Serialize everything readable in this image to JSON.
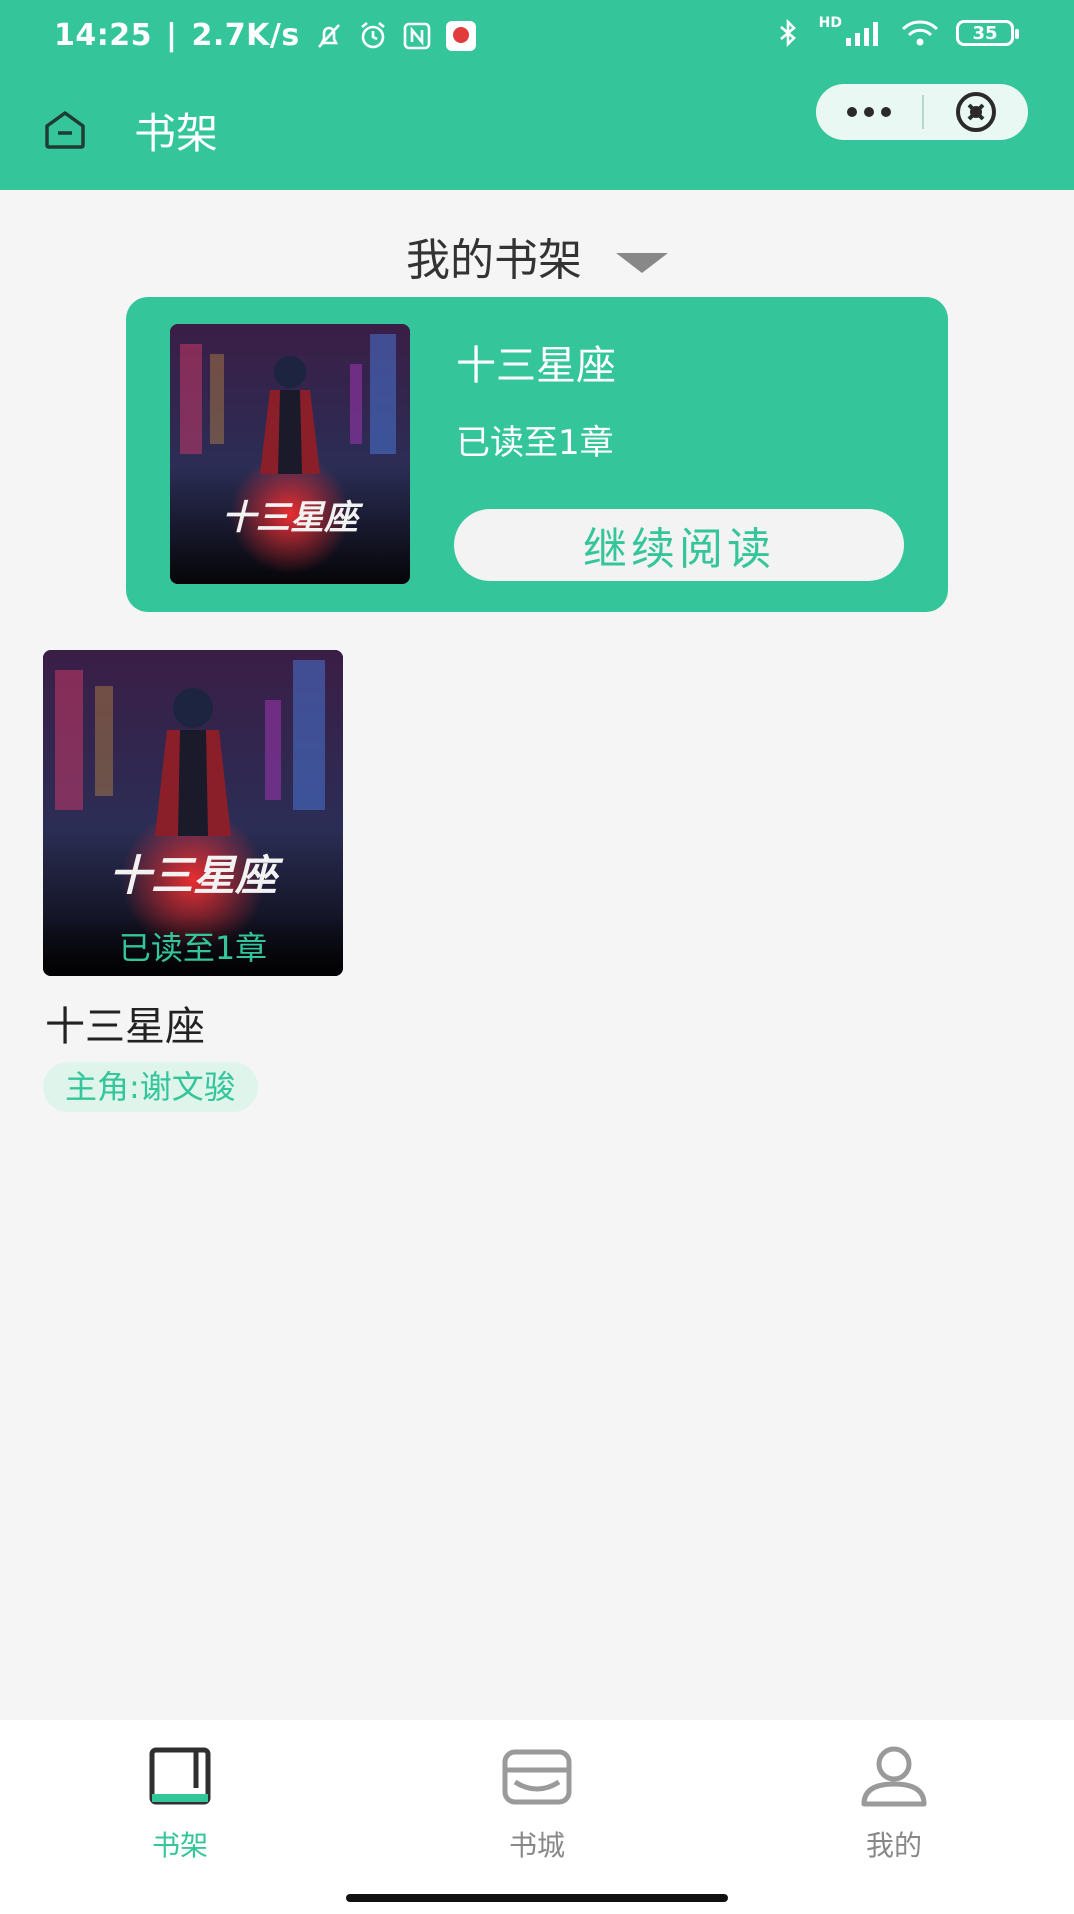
{
  "status_bar": {
    "time": "14:25",
    "network_speed": "2.7K/s",
    "signal_label": "HD",
    "battery": "35",
    "icons": [
      "mute-bell-icon",
      "alarm-icon",
      "nfc-icon",
      "app-notification-icon",
      "bluetooth-icon",
      "signal-icon",
      "wifi-icon",
      "battery-icon"
    ]
  },
  "header": {
    "title": "书架",
    "home_icon": "home-icon",
    "more_icon": "more-dots-icon",
    "close_icon": "close-circle-icon"
  },
  "shelf_selector": {
    "label": "我的书架",
    "icon": "dropdown-triangle-icon"
  },
  "continue_card": {
    "book_title": "十三星座",
    "progress": "已读至1章",
    "button_label": "继续阅读",
    "cover_title": "十三星座"
  },
  "books": [
    {
      "cover_title": "十三星座",
      "overlay": "已读至1章",
      "name": "十三星座",
      "tag": "主角:谢文骏"
    }
  ],
  "tabs": [
    {
      "label": "书架",
      "icon": "bookshelf-icon",
      "active": true
    },
    {
      "label": "书城",
      "icon": "store-icon",
      "active": false
    },
    {
      "label": "我的",
      "icon": "user-icon",
      "active": false
    }
  ],
  "colors": {
    "accent": "#34c69a",
    "background": "#f5f5f5",
    "tag_bg": "#dff5ec"
  }
}
